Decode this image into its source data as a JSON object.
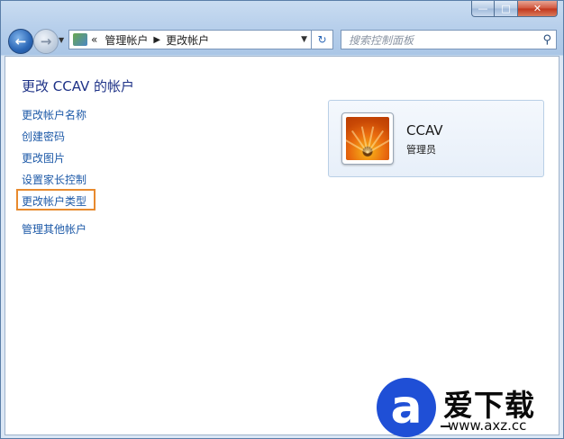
{
  "window": {
    "minimize_glyph": "—",
    "maximize_glyph": "□",
    "close_glyph": "✕"
  },
  "nav": {
    "back_glyph": "←",
    "forward_glyph": "→",
    "history_glyph": "▼",
    "breadcrumb_overflow": "«",
    "breadcrumb": [
      "管理帐户",
      "更改帐户"
    ],
    "breadcrumb_separator": "▶",
    "address_dropdown": "▼",
    "refresh_glyph": "↻",
    "search_placeholder": "搜索控制面板",
    "search_icon_glyph": "⚲"
  },
  "page": {
    "title": "更改 CCAV 的帐户",
    "links": [
      {
        "label": "更改帐户名称"
      },
      {
        "label": "创建密码"
      },
      {
        "label": "更改图片"
      },
      {
        "label": "设置家长控制"
      },
      {
        "label": "更改帐户类型",
        "highlighted": true
      },
      {
        "label": "管理其他帐户"
      }
    ],
    "highlight_color": "#e88a2e",
    "link_color": "#1e5aa8",
    "title_color": "#1e3287"
  },
  "account": {
    "name": "CCAV",
    "role": "管理员",
    "picture": "orange-flower-icon"
  },
  "watermark": {
    "logo_letter": "a",
    "text": "爱下载",
    "url": "www.axz.cc",
    "logo_color": "#1f4fd6"
  }
}
